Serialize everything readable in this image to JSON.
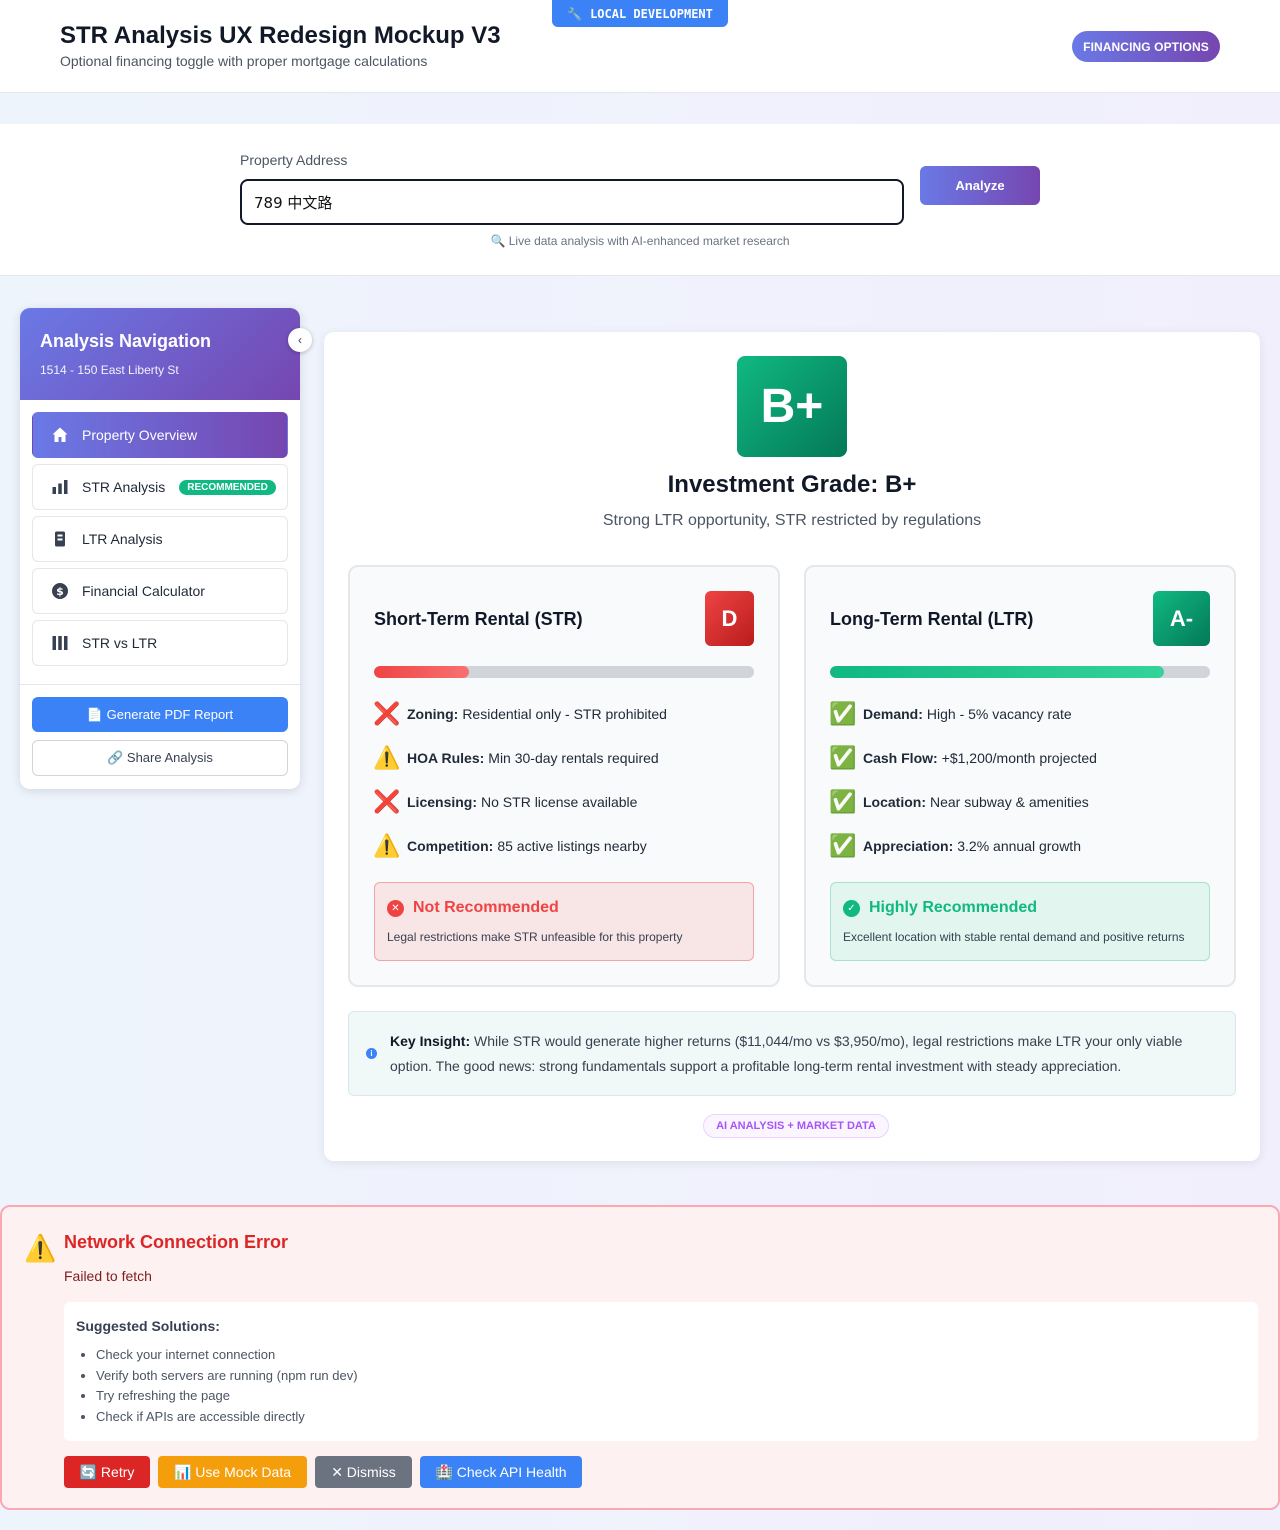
{
  "header": {
    "title": "STR Analysis UX Redesign Mockup V3",
    "subtitle": "Optional financing toggle with proper mortgage calculations",
    "dev_badge": "LOCAL DEVELOPMENT",
    "financing_button": "FINANCING OPTIONS"
  },
  "search": {
    "label": "Property Address",
    "value": "789 中文路",
    "analyze_button": "Analyze",
    "hint": "🔍 Live data analysis with AI-enhanced market research"
  },
  "sidebar": {
    "title": "Analysis Navigation",
    "address": "1514 - 150 East Liberty St",
    "items": [
      {
        "label": "Property Overview",
        "icon": "home-icon",
        "active": true
      },
      {
        "label": "STR Analysis",
        "icon": "bar-chart-icon",
        "badge": "RECOMMENDED"
      },
      {
        "label": "LTR Analysis",
        "icon": "building-icon"
      },
      {
        "label": "Financial Calculator",
        "icon": "dollar-icon"
      },
      {
        "label": "STR vs LTR",
        "icon": "columns-icon"
      }
    ],
    "pdf_button": "📄 Generate PDF Report",
    "share_button": "🔗 Share Analysis"
  },
  "overview": {
    "grade": "B+",
    "grade_title": "Investment Grade: B+",
    "grade_subtitle": "Strong LTR opportunity, STR restricted by regulations",
    "str": {
      "title": "Short-Term Rental (STR)",
      "grade": "D",
      "score_percent": 25,
      "factors": [
        {
          "icon": "❌",
          "label": "Zoning:",
          "text": "Residential only - STR prohibited"
        },
        {
          "icon": "⚠️",
          "label": "HOA Rules:",
          "text": "Min 30-day rentals required"
        },
        {
          "icon": "❌",
          "label": "Licensing:",
          "text": "No STR license available"
        },
        {
          "icon": "⚠️",
          "label": "Competition:",
          "text": "85 active listings nearby"
        }
      ],
      "verdict_title": "Not Recommended",
      "verdict_text": "Legal restrictions make STR unfeasible for this property"
    },
    "ltr": {
      "title": "Long-Term Rental (LTR)",
      "grade": "A-",
      "score_percent": 88,
      "factors": [
        {
          "icon": "✅",
          "label": "Demand:",
          "text": "High - 5% vacancy rate"
        },
        {
          "icon": "✅",
          "label": "Cash Flow:",
          "text": "+$1,200/month projected"
        },
        {
          "icon": "✅",
          "label": "Location:",
          "text": "Near subway & amenities"
        },
        {
          "icon": "✅",
          "label": "Appreciation:",
          "text": "3.2% annual growth"
        }
      ],
      "verdict_title": "Highly Recommended",
      "verdict_text": "Excellent location with stable rental demand and positive returns"
    },
    "insight_label": "Key Insight:",
    "insight_text": "While STR would generate higher returns ($11,044/mo vs $3,950/mo), legal restrictions make LTR your only viable option. The good news: strong fundamentals support a profitable long-term rental investment with steady appreciation.",
    "ai_badge": "AI ANALYSIS + MARKET DATA"
  },
  "error": {
    "title": "Network Connection Error",
    "message": "Failed to fetch",
    "solutions_title": "Suggested Solutions:",
    "solutions": [
      "Check your internet connection",
      "Verify both servers are running (npm run dev)",
      "Try refreshing the page",
      "Check if APIs are accessible directly"
    ],
    "buttons": {
      "retry": "🔄 Retry",
      "mock": "📊 Use Mock Data",
      "dismiss": "✕ Dismiss",
      "health": "🏥 Check API Health"
    }
  },
  "colors": {
    "accent_start": "#6a79e6",
    "accent_end": "#7646b0",
    "success": "#10b981",
    "danger": "#dc2626",
    "info": "#3b82f6"
  }
}
